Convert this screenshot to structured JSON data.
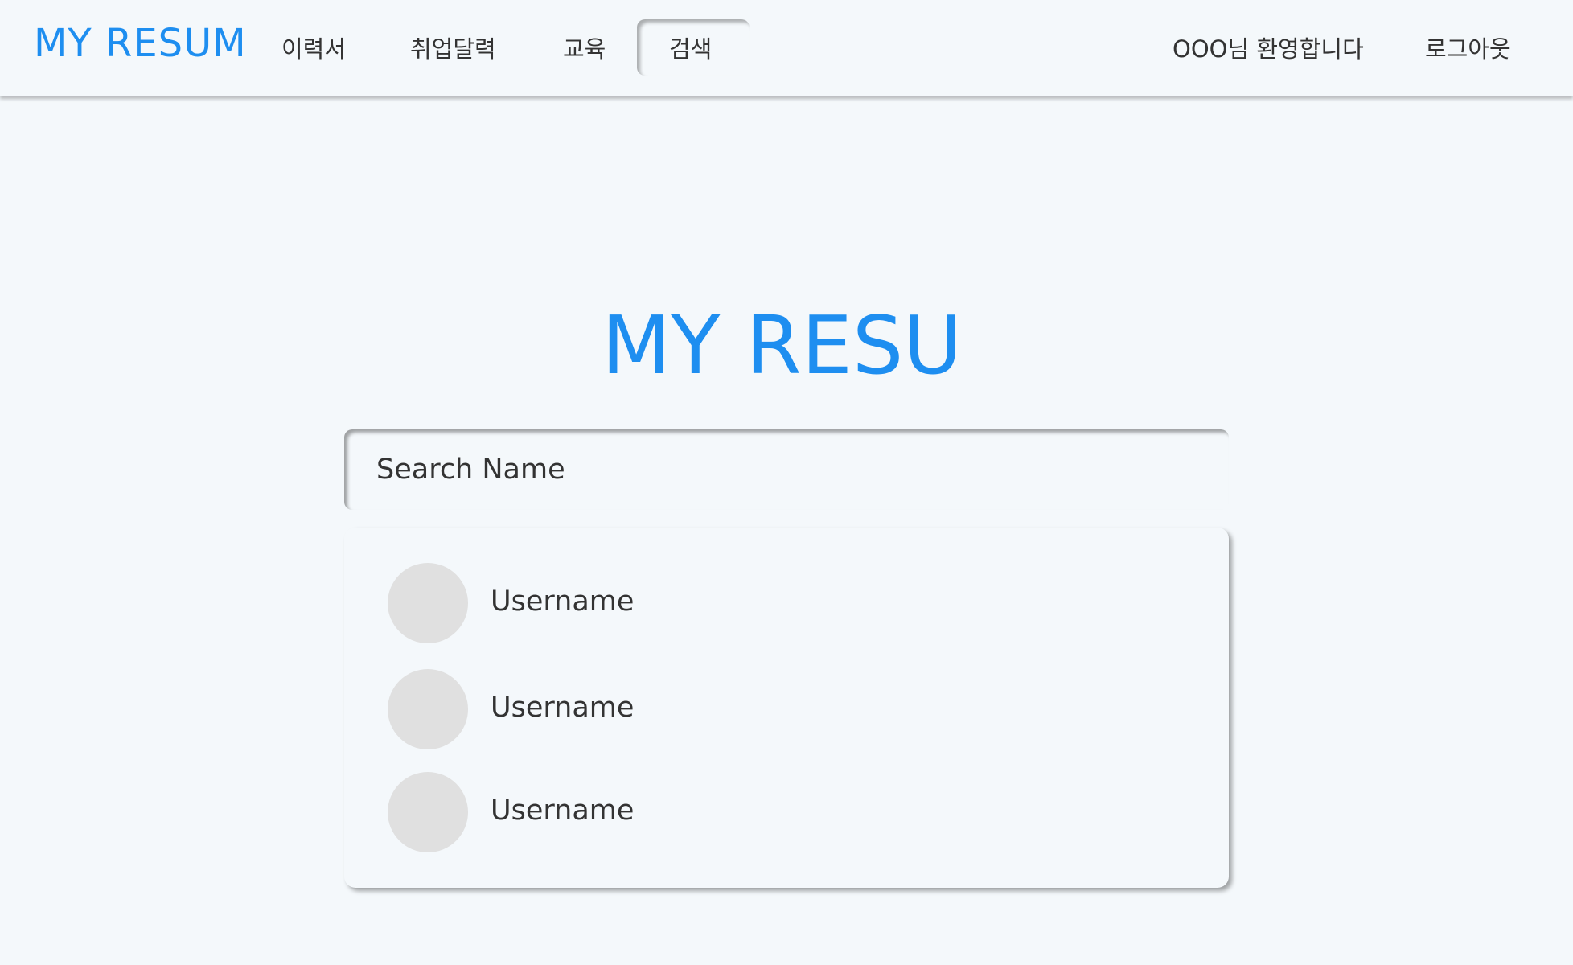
{
  "header": {
    "brand": "MY RESUM",
    "nav": [
      {
        "label": "이력서"
      },
      {
        "label": "취업달력"
      },
      {
        "label": "교육"
      },
      {
        "label": "검색",
        "active": true
      }
    ],
    "welcome": "OOO님 환영합니다",
    "logout": "로그아웃"
  },
  "main": {
    "title": "MY RESUME",
    "search": {
      "placeholder": "Search Name",
      "value": ""
    },
    "results": [
      {
        "username": "Username"
      },
      {
        "username": "Username"
      },
      {
        "username": "Username"
      }
    ]
  },
  "colors": {
    "accent": "#1e8ef0",
    "background": "#f4f8fb",
    "avatar": "#e0e0e0",
    "text": "#333333"
  }
}
